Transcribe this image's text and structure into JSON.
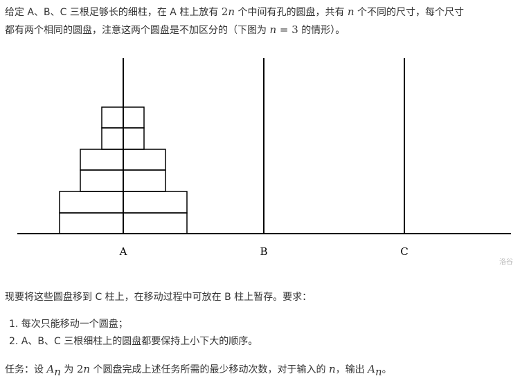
{
  "intro": {
    "l1a": "给定 A、B、C 三根足够长的细柱，在 A 柱上放有 ",
    "two": "2",
    "n": "n",
    "l1b": " 个中间有孔的圆盘，共有 ",
    "l1c": " 个不同的尺寸，每个尺寸",
    "l2a": "都有两个相同的圆盘，注意这两个圆盘是不加区分的（下图为 ",
    "eq": " = 3",
    "l2b": " 的情形）。"
  },
  "figure": {
    "labels": [
      "A",
      "B",
      "C"
    ],
    "watermark": "洛谷",
    "n": 3,
    "discs_per_size": 2
  },
  "move_text": "现要将这些圆盘移到 C 柱上，在移动过程中可放在 B 柱上暂存。要求：",
  "rules": [
    "1. 每次只能移动一个圆盘；",
    "2. A、B、C 三根细柱上的圆盘都要保持上小下大的顺序。"
  ],
  "task": {
    "a": "任务：设 ",
    "A": "A",
    "n": "n",
    "b": " 为 ",
    "two": "2",
    "c": " 个圆盘完成上述任务所需的最少移动次数，对于输入的 ",
    "d": "，输出 ",
    "e": "。"
  }
}
